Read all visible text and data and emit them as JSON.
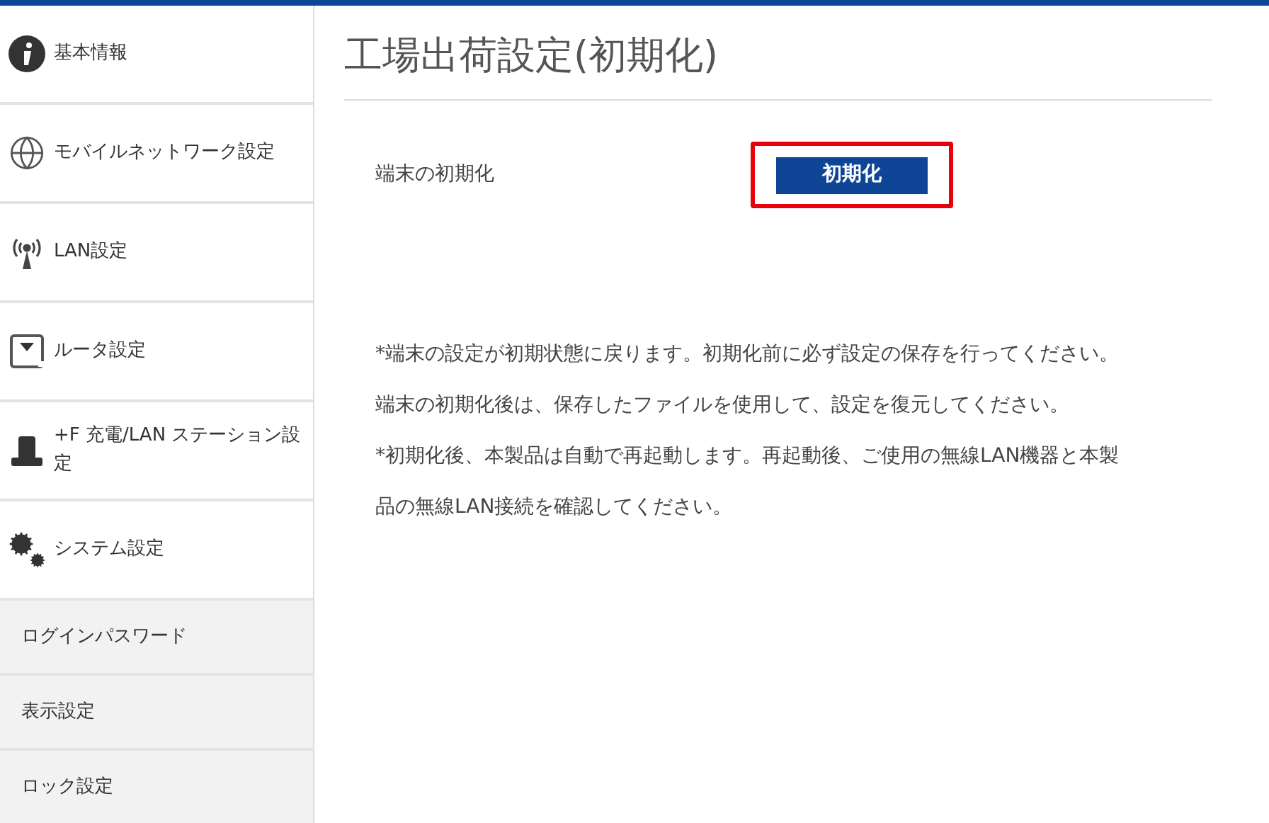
{
  "sidebar": {
    "items": [
      {
        "kind": "main",
        "label": "基本情報"
      },
      {
        "kind": "main",
        "label": "モバイルネットワーク設定"
      },
      {
        "kind": "main",
        "label": "LAN設定"
      },
      {
        "kind": "main",
        "label": "ルータ設定"
      },
      {
        "kind": "main",
        "label": "+F 充電/LAN ステーション設定"
      },
      {
        "kind": "main",
        "label": "システム設定"
      },
      {
        "kind": "sub",
        "label": "ログインパスワード"
      },
      {
        "kind": "sub",
        "label": "表示設定"
      },
      {
        "kind": "sub",
        "label": "ロック設定"
      }
    ]
  },
  "page_title": "工場出荷設定(初期化)",
  "setting": {
    "label": "端末の初期化",
    "button": "初期化",
    "highlighted": true
  },
  "notes": [
    "*端末の設定が初期状態に戻ります。初期化前に必ず設定の保存を行ってください。端末の初期化後は、保存したファイルを使用して、設定を復元してください。",
    "*初期化後、本製品は自動で再起動します。再起動後、ご使用の無線LAN機器と本製品の無線LAN接続を確認してください。"
  ]
}
